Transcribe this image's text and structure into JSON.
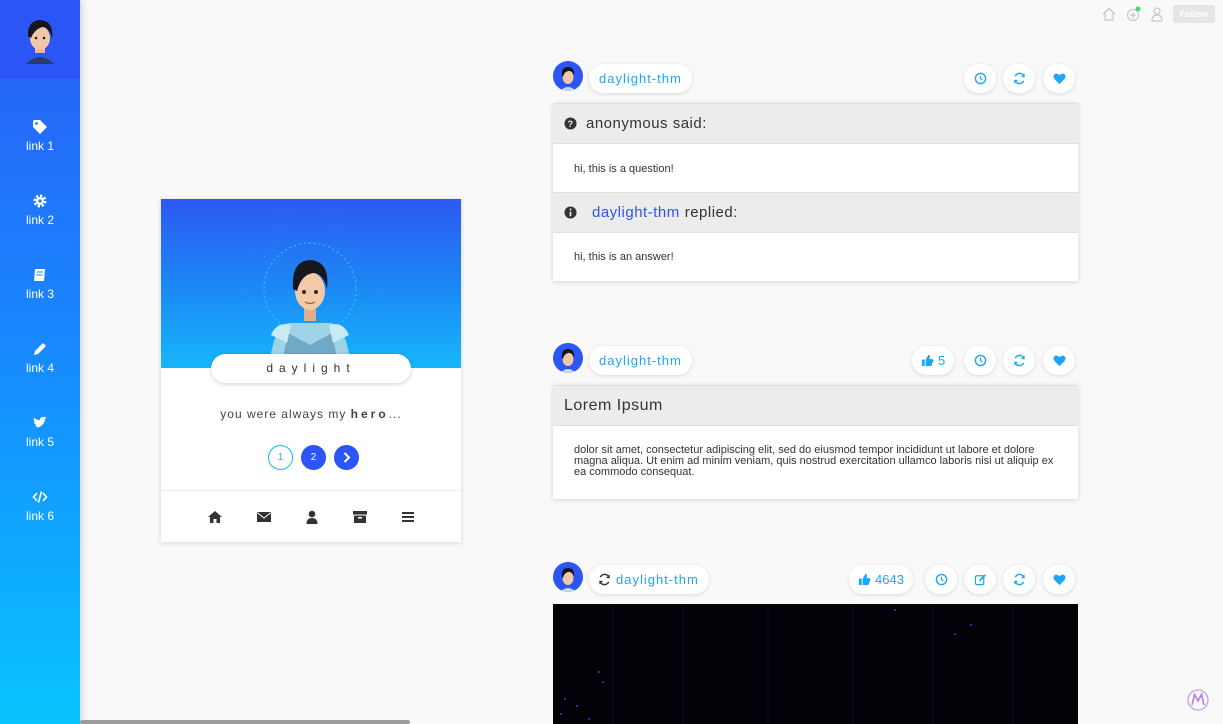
{
  "sidebar": {
    "links": [
      {
        "label": "link 1",
        "icon": "tag-icon"
      },
      {
        "label": "link 2",
        "icon": "gear-icon"
      },
      {
        "label": "link 3",
        "icon": "book-icon"
      },
      {
        "label": "link 4",
        "icon": "pencil-icon"
      },
      {
        "label": "link 5",
        "icon": "twitter-icon"
      },
      {
        "label": "link 6",
        "icon": "code-icon"
      }
    ]
  },
  "topbar": {
    "follow_label": "Follow"
  },
  "profile": {
    "name": "daylight",
    "desc_prefix": "you were always my",
    "desc_bold": "hero",
    "desc_suffix": "...",
    "pages": [
      "1",
      "2"
    ]
  },
  "posts": [
    {
      "username": "daylight-thm",
      "question_label": "anonymous said:",
      "question_text": "hi, this is a question!",
      "answer_user": "daylight-thm",
      "answer_label": "replied:",
      "answer_text": "hi, this is an answer!"
    },
    {
      "username": "daylight-thm",
      "likes": "5",
      "title": "Lorem Ipsum",
      "body": "dolor sit amet, consectetur adipiscing elit, sed do eiusmod tempor incididunt ut labore et dolore magna aliqua. Ut enim ad minim veniam, quis nostrud exercitation ullamco laboris nisi ut aliquip ex ea commodo consequat."
    },
    {
      "username": "daylight-thm",
      "likes": "4643"
    }
  ],
  "colors": {
    "accent": "#1ea5f5",
    "brand_blue": "#2b55f4"
  }
}
